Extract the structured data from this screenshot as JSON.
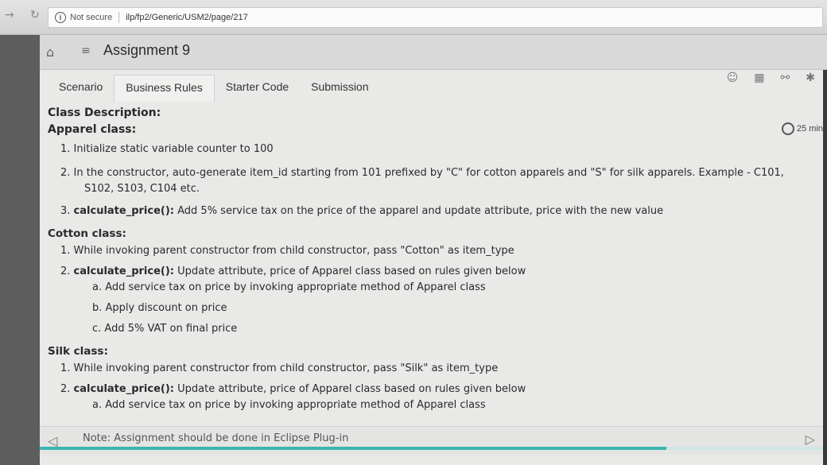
{
  "browser": {
    "security": "Not secure",
    "url": "ilp/fp2/Generic/USM2/page/217"
  },
  "app": {
    "title": "Assignment 9"
  },
  "tabs": [
    "Scenario",
    "Business Rules",
    "Starter Code",
    "Submission"
  ],
  "timer": {
    "label": "25 min"
  },
  "content": {
    "heading": "Class Description:",
    "apparel": {
      "title": "Apparel class:",
      "items": [
        {
          "num": "1.",
          "bold": "",
          "text": "Initialize static variable counter to 100"
        },
        {
          "num": "2.",
          "bold": "",
          "text": "In the constructor, auto-generate item_id starting from 101 prefixed by \"C\" for cotton apparels and \"S\" for silk apparels. Example - C101,",
          "text2": "S102, S103, C104 etc."
        },
        {
          "num": "3.",
          "bold": "calculate_price():",
          "text": "Add 5% service tax on the price of the apparel and update attribute, price with the new value"
        }
      ]
    },
    "cotton": {
      "title": "Cotton class:",
      "items": [
        {
          "num": "1.",
          "bold": "",
          "text": "While invoking parent constructor from child constructor, pass \"Cotton\" as item_type"
        },
        {
          "num": "2.",
          "bold": "calculate_price():",
          "text": "Update attribute, price of Apparel class based on rules given below"
        }
      ],
      "sub": [
        "a. Add service tax on price by invoking appropriate method of Apparel class",
        "b. Apply discount on price",
        "c. Add 5% VAT on final price"
      ]
    },
    "silk": {
      "title": "Silk class:",
      "items": [
        {
          "num": "1.",
          "bold": "",
          "text": "While invoking parent constructor from child constructor, pass \"Silk\" as item_type"
        },
        {
          "num": "2.",
          "bold": "calculate_price():",
          "text": "Update attribute, price of Apparel class based on rules given below"
        }
      ],
      "sub": [
        "a. Add service tax on price by invoking appropriate method of Apparel class"
      ]
    }
  },
  "footer": {
    "note": "Note: Assignment should be done in Eclipse Plug-in",
    "progress": 0.8
  },
  "icons": [
    "back-icon",
    "reload-icon",
    "info-icon",
    "home-icon",
    "menu-icon",
    "smile-icon",
    "calendar-icon",
    "share-icon",
    "settings-icon",
    "timer-icon",
    "prev-arrow-icon",
    "next-arrow-icon"
  ]
}
